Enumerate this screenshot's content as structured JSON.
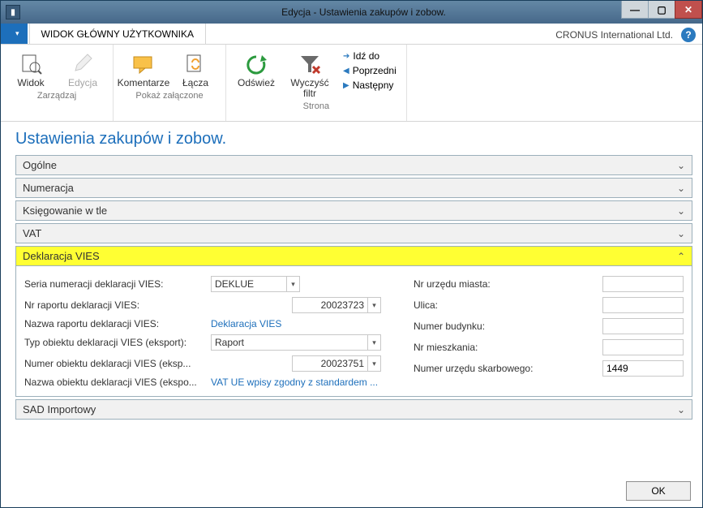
{
  "titlebar": {
    "title": "Edycja - Ustawienia zakupów i zobow."
  },
  "sysbtns": {
    "min": "—",
    "max": "▢",
    "close": "✕"
  },
  "tabs": {
    "main": "WIDOK GŁÓWNY UŻYTKOWNIKA"
  },
  "company": "CRONUS International Ltd.",
  "ribbon": {
    "groups": {
      "manage": {
        "name": "Zarządzaj",
        "view": "Widok",
        "edit": "Edycja"
      },
      "attach": {
        "name": "Pokaż załączone",
        "comments": "Komentarze",
        "links": "Łącza"
      },
      "page": {
        "name": "Strona",
        "refresh": "Odśwież",
        "clear": "Wyczyść filtr",
        "goto": "Idź do",
        "prev": "Poprzedni",
        "next": "Następny"
      }
    }
  },
  "page": {
    "title": "Ustawienia zakupów i zobow.",
    "tabs": {
      "general": "Ogólne",
      "numbering": "Numeracja",
      "bgpost": "Księgowanie w tle",
      "vat": "VAT",
      "vies": "Deklaracja VIES",
      "sad": "SAD Importowy"
    },
    "vies": {
      "left": {
        "series_lbl": "Seria numeracji deklaracji VIES:",
        "series_val": "DEKLUE",
        "reportno_lbl": "Nr raportu deklaracji VIES:",
        "reportno_val": "20023723",
        "reportname_lbl": "Nazwa raportu deklaracji VIES:",
        "reportname_link": "Deklaracja VIES",
        "objtype_lbl": "Typ obiektu deklaracji VIES (eksport):",
        "objtype_val": "Raport",
        "objno_lbl": "Numer obiektu deklaracji VIES (eksp...",
        "objno_val": "20023751",
        "objname_lbl": "Nazwa obiektu deklaracji VIES (ekspo...",
        "objname_link": "VAT UE wpisy zgodny z standardem ..."
      },
      "right": {
        "city_lbl": "Nr urzędu miasta:",
        "city_val": "",
        "street_lbl": "Ulica:",
        "street_val": "",
        "house_lbl": "Numer budynku:",
        "house_val": "",
        "flat_lbl": "Nr mieszkania:",
        "flat_val": "",
        "taxoff_lbl": "Numer urzędu skarbowego:",
        "taxoff_val": "1449"
      }
    }
  },
  "footer": {
    "ok": "OK"
  }
}
